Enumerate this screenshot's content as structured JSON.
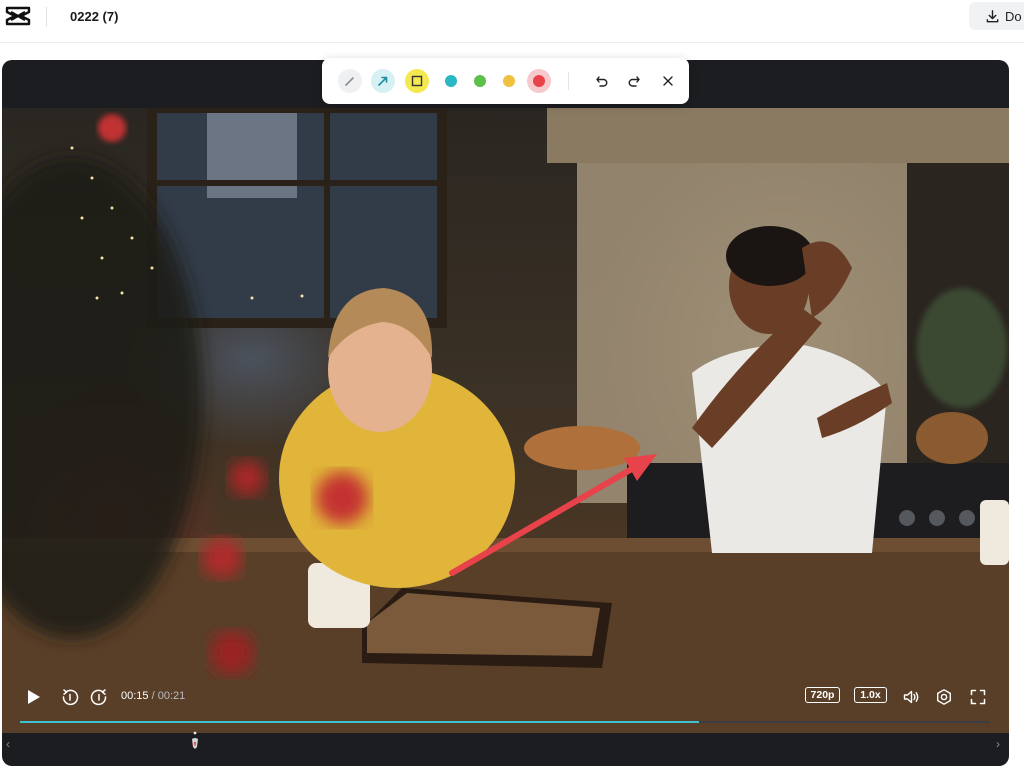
{
  "app": {
    "project_title": "0222 (7)",
    "download_label": "Do",
    "logo_icon": "capcut-logo-icon"
  },
  "annotation_toolbar": {
    "tools": [
      {
        "name": "pen-icon",
        "active": false
      },
      {
        "name": "arrow-icon",
        "active": false
      },
      {
        "name": "rectangle-icon",
        "active": true
      }
    ],
    "colors": [
      "#2bb7c4",
      "#5cc04a",
      "#f0c040",
      "#e8424a"
    ],
    "selected_color": "#e8424a",
    "undo_icon": "undo-icon",
    "redo_icon": "redo-icon",
    "close_icon": "close-icon"
  },
  "video": {
    "annotation_color": "#e8424a"
  },
  "controls": {
    "current_time": "00:15",
    "separator": " / ",
    "total_time": "00:21",
    "quality": "720p",
    "speed": "1.0x",
    "progress_percent": 70,
    "accent": "#3dc3cf"
  }
}
